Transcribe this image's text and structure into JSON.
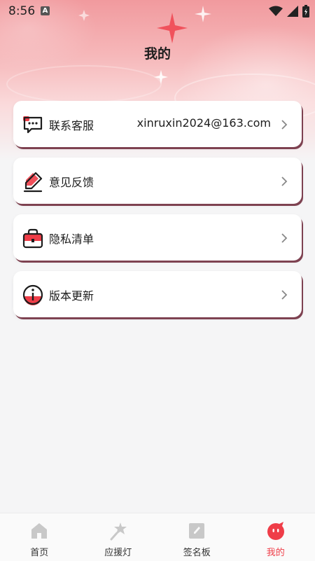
{
  "status_bar": {
    "time": "8:56",
    "notification_badge": "A"
  },
  "header": {
    "title": "我的"
  },
  "menu": [
    {
      "id": "contact",
      "label": "联系客服",
      "value": "xinruxin2024@163.com",
      "icon": "chat-bubble-icon"
    },
    {
      "id": "feedback",
      "label": "意见反馈",
      "icon": "pencil-edit-icon"
    },
    {
      "id": "privacy",
      "label": "隐私清单",
      "icon": "briefcase-lock-icon"
    },
    {
      "id": "version",
      "label": "版本更新",
      "icon": "info-icon"
    }
  ],
  "tab_bar": {
    "items": [
      {
        "label": "首页",
        "icon": "home-icon",
        "active": false
      },
      {
        "label": "应援灯",
        "icon": "light-stick-icon",
        "active": false
      },
      {
        "label": "签名板",
        "icon": "signature-board-icon",
        "active": false
      },
      {
        "label": "我的",
        "icon": "profile-face-icon",
        "active": true
      }
    ]
  },
  "colors": {
    "accent": "#ef3d48",
    "card_shadow": "#7e4251",
    "header_pink": "#f19a9e"
  }
}
